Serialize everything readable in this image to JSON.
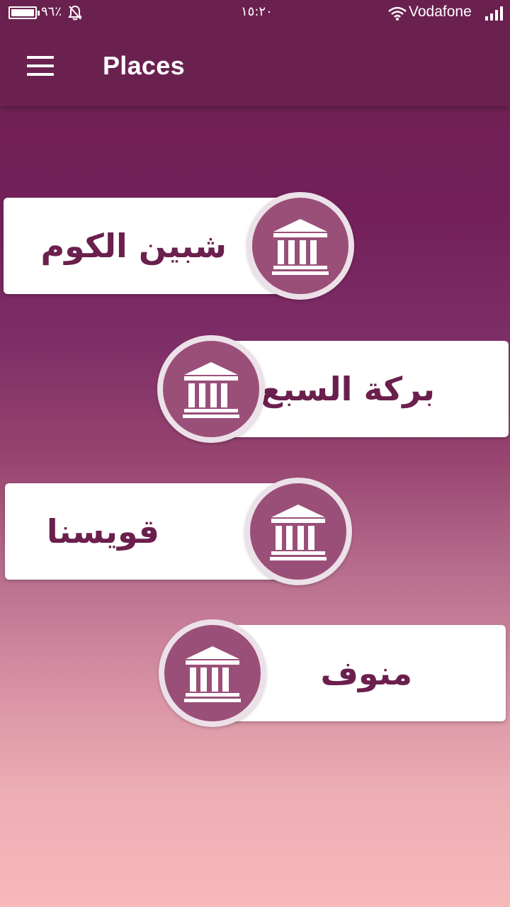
{
  "status_bar": {
    "battery_percent": "٩٦٪",
    "time": "١٥:٢٠",
    "carrier": "Vodafone",
    "icons": [
      "battery-icon",
      "bell-off-icon",
      "wifi-icon",
      "signal-icon"
    ]
  },
  "app_bar": {
    "title": "Places",
    "menu_icon": "hamburger-menu-icon"
  },
  "places": [
    {
      "name": "شبين الكوم",
      "icon": "museum-building-icon"
    },
    {
      "name": "بركة السبع",
      "icon": "museum-building-icon"
    },
    {
      "name": "قويسنا",
      "icon": "museum-building-icon"
    },
    {
      "name": "منوف",
      "icon": "museum-building-icon"
    }
  ],
  "colors": {
    "primary": "#6b2150",
    "badge": "#9a4f79",
    "text": "#6b1f4d",
    "gradient_end": "#f6b8b9"
  }
}
